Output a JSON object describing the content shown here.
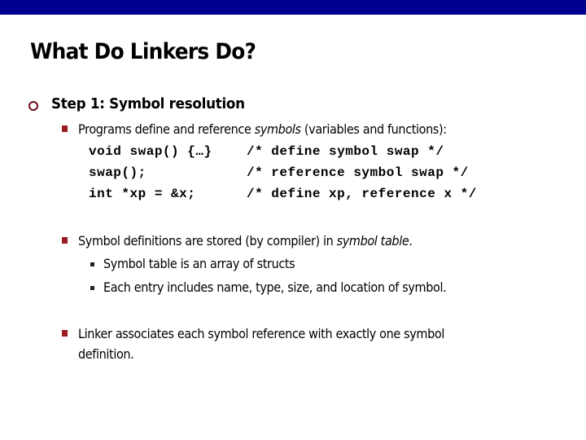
{
  "slide": {
    "title": "What Do Linkers Do?",
    "colors": {
      "top_bar": "#000090",
      "level1_bullet": "#6b0f1a",
      "level2_bullet": "#9b1b23",
      "text": "#000000"
    },
    "level1": {
      "bullet_icon": "hollow-circle",
      "text": "Step 1: Symbol resolution"
    },
    "points": [
      {
        "bullet_icon": "red-square",
        "text_before": "Programs define and reference ",
        "text_italic": "symbols",
        "text_after": " (variables and functions):"
      },
      {
        "bullet_icon": "red-square",
        "text_before": "Symbol definitions are stored (by compiler) in ",
        "text_italic": "symbol table",
        "text_after": "."
      },
      {
        "bullet_icon": "red-square",
        "line1": "Linker associates each symbol reference with exactly one symbol",
        "line2": "definition."
      }
    ],
    "code_lines": [
      {
        "code": "void swap() {…}",
        "comment": "/* define symbol swap */"
      },
      {
        "code": "swap();",
        "comment": "/* reference symbol swap */"
      },
      {
        "code": "int *xp = &x;",
        "comment": "/* define xp, reference x */"
      }
    ],
    "sub_points": [
      {
        "bullet_icon": "black-square",
        "text": "Symbol table is an array of structs"
      },
      {
        "bullet_icon": "black-square",
        "text": "Each entry includes name, type, size, and location of symbol."
      }
    ]
  }
}
